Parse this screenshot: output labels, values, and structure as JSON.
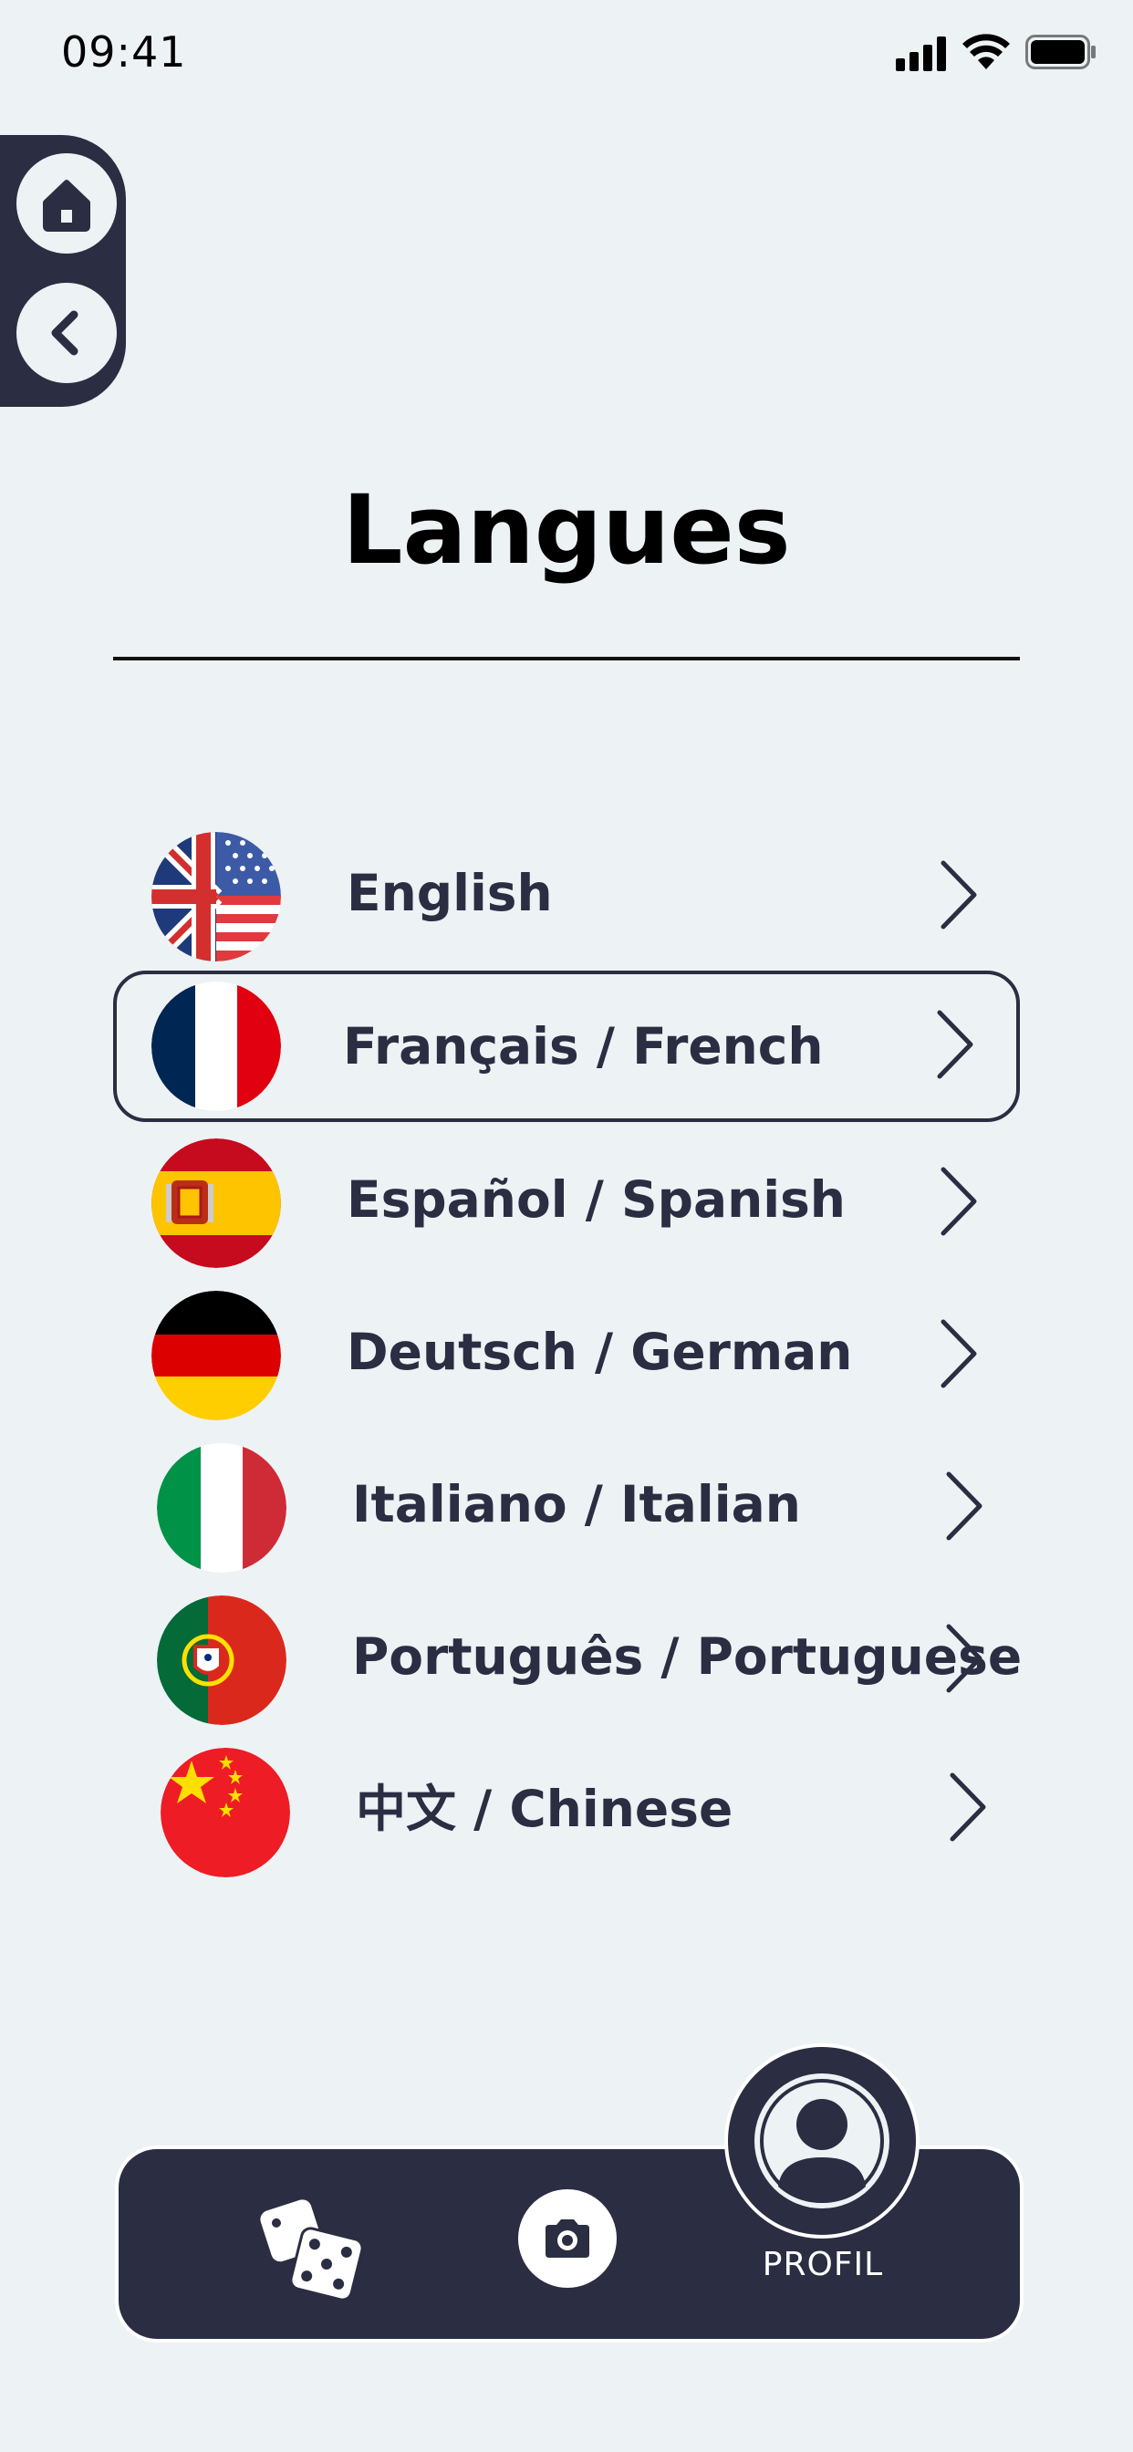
{
  "status_bar": {
    "time": "09:41"
  },
  "title": "Langues",
  "languages": [
    {
      "label": "English",
      "flag": "us-uk-flag-icon",
      "selected": false
    },
    {
      "label": "Français / French",
      "flag": "france-flag-icon",
      "selected": true
    },
    {
      "label": "Español / Spanish",
      "flag": "spain-flag-icon",
      "selected": false
    },
    {
      "label": "Deutsch / German",
      "flag": "germany-flag-icon",
      "selected": false
    },
    {
      "label": "Italiano / Italian",
      "flag": "italy-flag-icon",
      "selected": false
    },
    {
      "label": "Português / Portuguese",
      "flag": "portugal-flag-icon",
      "selected": false
    },
    {
      "label": "中文 / Chinese",
      "flag": "china-flag-icon",
      "selected": false
    }
  ],
  "tab_bar": {
    "profile_label": "PROFIL"
  },
  "colors": {
    "background": "#edf2f4",
    "primary": "#2b2d42",
    "text": "#2b2d42"
  }
}
